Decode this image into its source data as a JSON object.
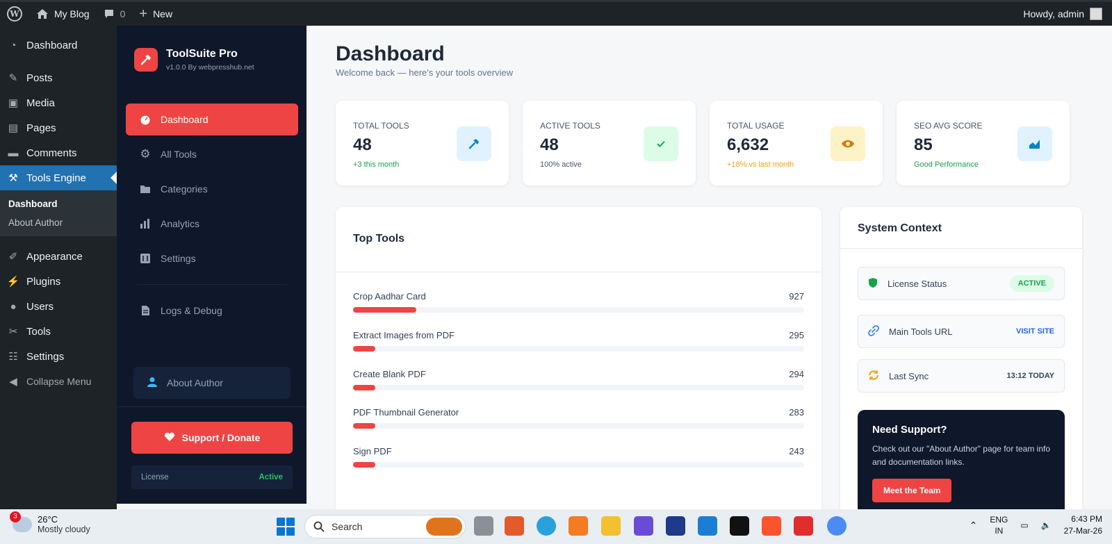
{
  "adminbar": {
    "site": "My Blog",
    "comments": "0",
    "new": "New",
    "greeting": "Howdy, admin"
  },
  "wp_menu": {
    "items": [
      {
        "label": "Dashboard",
        "icon": "dashboard-icon"
      },
      {
        "label": "Posts",
        "icon": "pin-icon"
      },
      {
        "label": "Media",
        "icon": "media-icon"
      },
      {
        "label": "Pages",
        "icon": "pages-icon"
      },
      {
        "label": "Comments",
        "icon": "comment-icon"
      },
      {
        "label": "Tools Engine",
        "icon": "hammer-icon"
      }
    ],
    "submenu": [
      "Dashboard",
      "About Author"
    ],
    "items2": [
      {
        "label": "Appearance",
        "icon": "brush-icon"
      },
      {
        "label": "Plugins",
        "icon": "plug-icon"
      },
      {
        "label": "Users",
        "icon": "user-icon"
      },
      {
        "label": "Tools",
        "icon": "wrench-icon"
      },
      {
        "label": "Settings",
        "icon": "settings-icon"
      }
    ],
    "collapse": "Collapse Menu"
  },
  "plugin": {
    "name": "ToolSuite Pro",
    "version": "v1.0.0  By webpresshub.net",
    "nav": [
      {
        "label": "Dashboard",
        "icon": "gauge-icon",
        "active": true
      },
      {
        "label": "All Tools",
        "icon": "gear-icon"
      },
      {
        "label": "Categories",
        "icon": "folder-icon"
      },
      {
        "label": "Analytics",
        "icon": "bar-chart-icon"
      },
      {
        "label": "Settings",
        "icon": "sliders-icon"
      }
    ],
    "logs": "Logs & Debug",
    "author": "About Author",
    "donate": "Support / Donate",
    "license_label": "License",
    "license_value": "Active"
  },
  "main": {
    "title": "Dashboard",
    "subtitle": "Welcome back — here's your tools overview",
    "stats": [
      {
        "label": "TOTAL TOOLS",
        "value": "48",
        "note": "+3 this month",
        "note_color": "#16a34a",
        "icon": "hammer-icon",
        "icon_bg": "#e0f2fe",
        "icon_color": "#0284c7"
      },
      {
        "label": "ACTIVE TOOLS",
        "value": "48",
        "note": "100% active",
        "note_color": "#475569",
        "icon": "check-icon",
        "icon_bg": "#dcfce7",
        "icon_color": "#16a34a"
      },
      {
        "label": "TOTAL USAGE",
        "value": "6,632",
        "note": "+18% vs last month",
        "note_color": "#f59e0b",
        "icon": "eye-icon",
        "icon_bg": "#fef3c7",
        "icon_color": "#d97706"
      },
      {
        "label": "SEO AVG SCORE",
        "value": "85",
        "note": "Good Performance",
        "note_color": "#16a34a",
        "icon": "area-chart-icon",
        "icon_bg": "#e0f2fe",
        "icon_color": "#0284c7"
      }
    ],
    "top_tools_title": "Top Tools",
    "top_tools": [
      {
        "name": "Crop Aadhar Card",
        "count": "927",
        "percent": 14
      },
      {
        "name": "Extract Images from PDF",
        "count": "295",
        "percent": 5
      },
      {
        "name": "Create Blank PDF",
        "count": "294",
        "percent": 5
      },
      {
        "name": "PDF Thumbnail Generator",
        "count": "283",
        "percent": 5
      },
      {
        "name": "Sign PDF",
        "count": "243",
        "percent": 5
      }
    ],
    "system_title": "System Context",
    "system": [
      {
        "label": "License Status",
        "value": "ACTIVE",
        "icon": "shield-icon"
      },
      {
        "label": "Main Tools URL",
        "value": "VISIT SITE",
        "icon": "link-icon"
      },
      {
        "label": "Last Sync",
        "value": "13:12 TODAY",
        "icon": "sync-icon"
      }
    ],
    "support": {
      "title": "Need Support?",
      "desc": "Check out our \"About Author\" page for team info and documentation links.",
      "button": "Meet the Team"
    }
  },
  "taskbar": {
    "temp": "26°C",
    "weather": "Mostly cloudy",
    "weather_badge": "3",
    "search": "Search",
    "lang1": "ENG",
    "lang2": "IN",
    "time": "6:43 PM",
    "date": "27-Mar-26"
  }
}
